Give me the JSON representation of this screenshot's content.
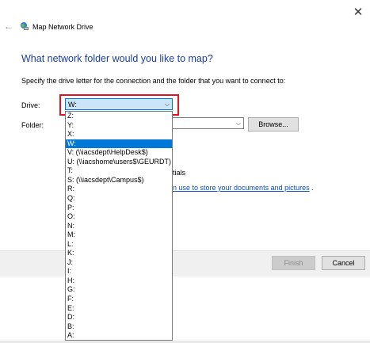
{
  "window": {
    "close_glyph": "✕",
    "back_glyph": "←",
    "title": "Map Network Drive",
    "title_icon": "network-drive-icon"
  },
  "heading": "What network folder would you like to map?",
  "instruction": "Specify the drive letter for the connection and the folder that you want to connect to:",
  "drive": {
    "label": "Drive:",
    "selected": "W:",
    "options": [
      "Z:",
      "Y:",
      "X:",
      "W:",
      "V: (\\\\iacsdept\\HelpDesk$)",
      "U: (\\\\iacshome\\users$\\GEURDT)",
      "T:",
      "S: (\\\\iacsdept\\Campus$)",
      "R:",
      "Q:",
      "P:",
      "O:",
      "N:",
      "M:",
      "L:",
      "K:",
      "J:",
      "I:",
      "H:",
      "G:",
      "F:",
      "E:",
      "D:",
      "B:",
      "A:"
    ]
  },
  "folder": {
    "label": "Folder:",
    "value": ""
  },
  "browse_label": "Browse...",
  "partial_text": {
    "credentials": "tials",
    "link": "n use to store your documents and pictures",
    "period": "."
  },
  "footer": {
    "finish_label": "Finish",
    "cancel_label": "Cancel"
  },
  "colors": {
    "heading": "#1a3e9a",
    "selection": "#0078d7",
    "highlight_box": "#e0141e",
    "link": "#0a4eb6"
  }
}
